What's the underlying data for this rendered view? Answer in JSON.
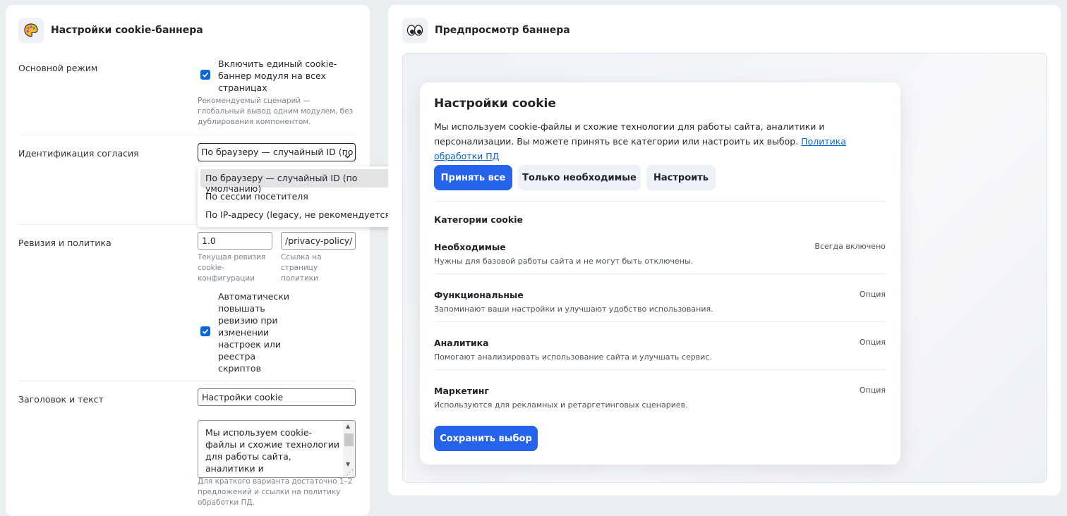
{
  "settings": {
    "title": "Настройки cookie-баннера",
    "icon": "palette-icon",
    "main_mode": {
      "label": "Основной режим",
      "checkbox_label": "Включить единый cookie-баннер модуля на всех страницах",
      "checked": true,
      "hint": "Рекомендуемый сценарий — глобальный вывод одним модулем, без дублирования компонентом."
    },
    "consent_id": {
      "label": "Идентификация согласия",
      "selected": "По браузеру — случайный ID (по умолчанию)",
      "options": [
        "По браузеру — случайный ID (по умолчанию)",
        "По сессии посетителя",
        "По IP-адресу (legacy, не рекомендуется)"
      ]
    },
    "revision": {
      "label": "Ревизия и политика",
      "revision_value": "1.0",
      "revision_hint": "Текущая ревизия cookie-конфигурации",
      "policy_value": "/privacy-policy/",
      "policy_hint": "Ссылка на страницу политики",
      "auto_label": "Автоматически повышать ревизию при изменении настроек или реестра скриптов",
      "auto_checked": true
    },
    "heading_text": {
      "label": "Заголовок и текст",
      "title_value": "Настройки cookie",
      "text_value": "Мы используем cookie-файлы и схожие технологии для работы сайта, аналитики и персонализации. Вы можете",
      "hint": "Для краткого варианта достаточно 1–2 предложений и ссылки на политику обработки ПД."
    }
  },
  "preview": {
    "title": "Предпросмотр баннера",
    "icon": "eyes-icon",
    "banner": {
      "title": "Настройки cookie",
      "text": "Мы используем cookie-файлы и схожие технологии для работы сайта, аналитики и персонализации. Вы можете принять все категории или настроить их выбор.",
      "policy_link": "Политика обработки ПД",
      "accept_all": "Принять все",
      "necessary_only": "Только необходимые",
      "configure": "Настроить",
      "categories_title": "Категории cookie",
      "categories": [
        {
          "name": "Необходимые",
          "desc": "Нужны для базовой работы сайта и не могут быть отключены.",
          "status": "Всегда включено"
        },
        {
          "name": "Функциональные",
          "desc": "Запоминают ваши настройки и улучшают удобство использования.",
          "status": "Опция"
        },
        {
          "name": "Аналитика",
          "desc": "Помогают анализировать использование сайта и улучшать сервис.",
          "status": "Опция"
        },
        {
          "name": "Маркетинг",
          "desc": "Используются для рекламных и ретаргетинговых сценариев.",
          "status": "Опция"
        }
      ],
      "save": "Сохранить выбор"
    }
  },
  "colors": {
    "primary": "#2563eb",
    "checkbox": "#0a66d6",
    "page_bg": "#e9eef0"
  }
}
